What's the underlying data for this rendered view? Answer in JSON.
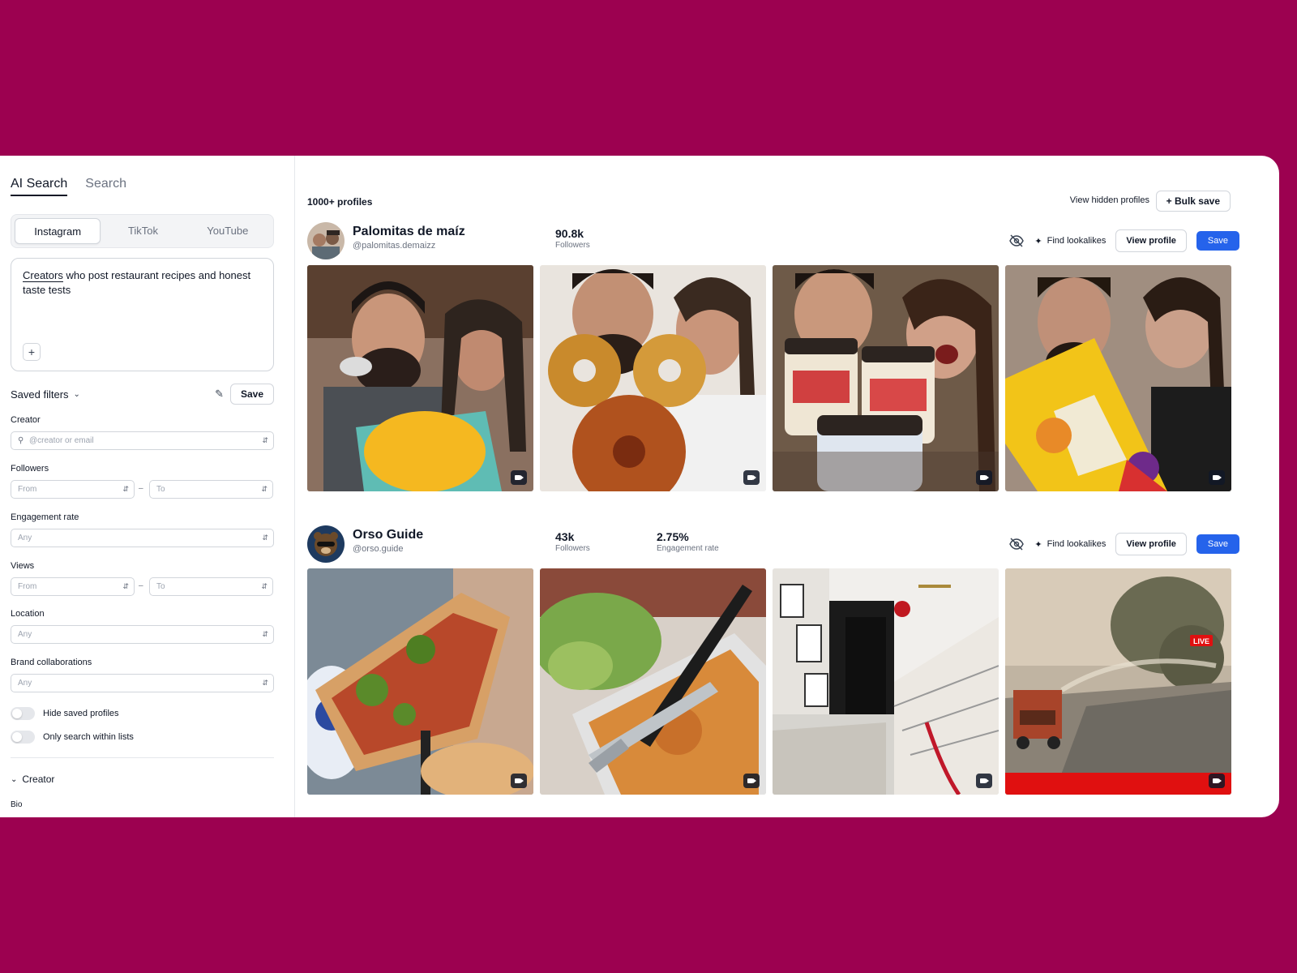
{
  "sidebar": {
    "tabs": [
      {
        "label": "AI Search"
      },
      {
        "label": "Search"
      }
    ],
    "platforms": [
      {
        "label": "Instagram"
      },
      {
        "label": "TikTok"
      },
      {
        "label": "YouTube"
      }
    ],
    "prompt": {
      "highlight": "Creators",
      "rest": " who post restaurant recipes and honest taste tests",
      "add_label": "+"
    },
    "saved_filters": {
      "label": "Saved filters",
      "save_label": "Save"
    },
    "filters": {
      "creator": {
        "label": "Creator",
        "placeholder": "@creator or email"
      },
      "followers": {
        "label": "Followers",
        "from": "From",
        "to": "To"
      },
      "engagement": {
        "label": "Engagement rate",
        "value": "Any"
      },
      "views": {
        "label": "Views",
        "from": "From",
        "to": "To"
      },
      "location": {
        "label": "Location",
        "value": "Any"
      },
      "brand": {
        "label": "Brand collaborations",
        "value": "Any"
      }
    },
    "toggles": [
      {
        "label": "Hide saved profiles"
      },
      {
        "label": "Only search within lists"
      }
    ],
    "section": {
      "label": "Creator",
      "bio_label": "Bio"
    }
  },
  "main": {
    "count": "1000+ profiles",
    "view_hidden": "View hidden profiles",
    "bulk_save": "+ Bulk save",
    "profiles": [
      {
        "name": "Palomitas de maíz",
        "handle": "@palomitas.demaizz",
        "stats": [
          {
            "value": "90.8k",
            "label": "Followers"
          }
        ],
        "actions": {
          "lookalikes": "Find lookalikes",
          "view": "View profile",
          "save": "Save"
        }
      },
      {
        "name": "Orso Guide",
        "handle": "@orso.guide",
        "stats": [
          {
            "value": "43k",
            "label": "Followers"
          },
          {
            "value": "2.75%",
            "label": "Engagement rate"
          }
        ],
        "actions": {
          "lookalikes": "Find lookalikes",
          "view": "View profile",
          "save": "Save"
        },
        "live_label": "LIVE"
      }
    ]
  },
  "colors": {
    "background": "#9c0150",
    "primary": "#2563eb"
  }
}
